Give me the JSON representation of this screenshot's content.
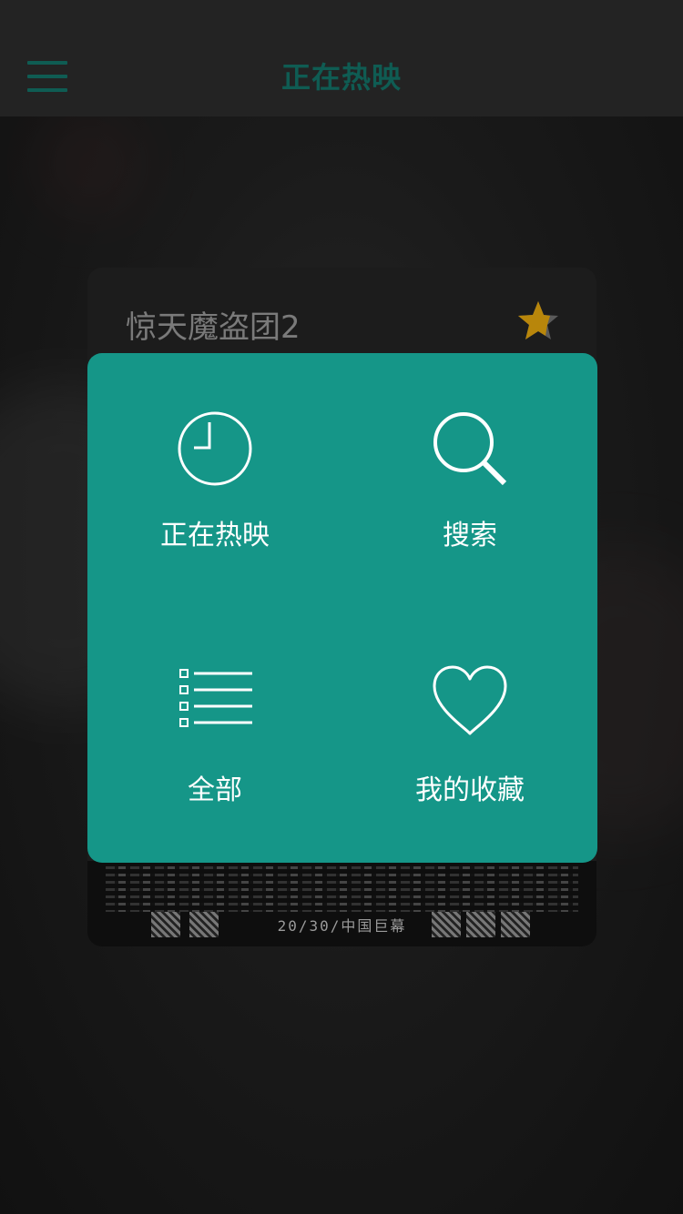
{
  "header": {
    "title": "正在热映",
    "menu_icon": "hamburger-menu-icon"
  },
  "movie": {
    "title": "惊天魔盗团2",
    "favorite_icon": "star-icon",
    "poster_date": "20/30/中国巨幕"
  },
  "popup_menu": {
    "items": [
      {
        "label": "正在热映",
        "icon": "clock-icon"
      },
      {
        "label": "搜索",
        "icon": "search-icon"
      },
      {
        "label": "全部",
        "icon": "list-icon"
      },
      {
        "label": "我的收藏",
        "icon": "heart-icon"
      }
    ]
  },
  "colors": {
    "accent": "#159688",
    "header_accent": "#0f5c53",
    "star": "#b8860b"
  }
}
